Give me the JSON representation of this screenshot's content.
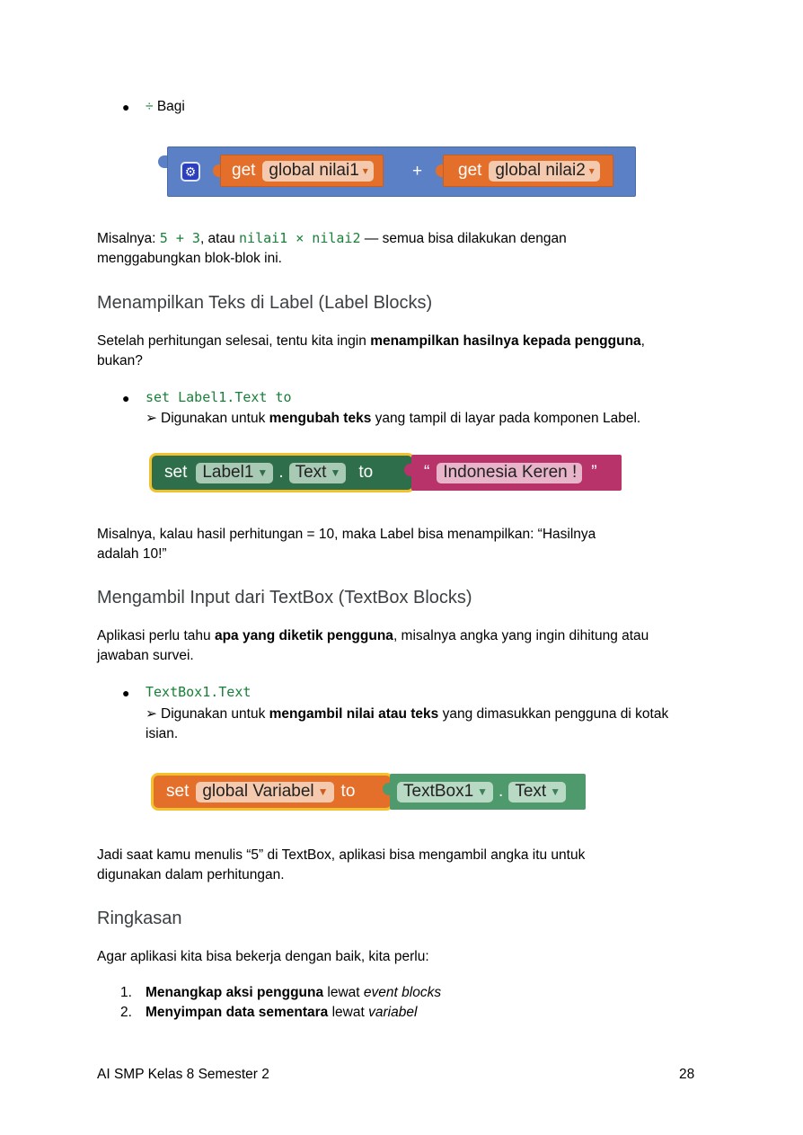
{
  "bullet_divide": {
    "symbol": "÷",
    "label": "Bagi"
  },
  "math_block": {
    "get_left": "get",
    "var_left": "global nilai1",
    "operator": "+",
    "get_right": "get",
    "var_right": "global nilai2",
    "dropdown": "▾"
  },
  "example1": {
    "prefix": "Misalnya: ",
    "code1": "5 + 3",
    "mid": ", atau ",
    "code2": "nilai1 × nilai2",
    "suffix": " — semua bisa dilakukan dengan",
    "line2": "menggabungkan blok-blok ini."
  },
  "section_label": {
    "heading": "Menampilkan Teks di Label (Label Blocks)",
    "intro_pre": "Setelah perhitungan selesai, tentu kita ingin ",
    "intro_bold": "menampilkan hasilnya kepada pengguna",
    "intro_post": ",",
    "intro_line2": "bukan?",
    "bullet_code": "set Label1.Text to",
    "desc_arrow": "➢",
    "desc_pre": "Digunakan untuk ",
    "desc_bold": "mengubah teks",
    "desc_post": " yang tampil di layar pada komponen Label.",
    "block": {
      "set": "set",
      "component": "Label1",
      "dot": ".",
      "property": "Text",
      "to": "to",
      "quote_open": "“",
      "text": "Indonesia Keren !",
      "quote_close": "”"
    },
    "example_line1": "Misalnya, kalau hasil perhitungan = 10, maka Label bisa menampilkan: “Hasilnya",
    "example_line2": "adalah 10!”"
  },
  "section_textbox": {
    "heading": "Mengambil Input dari TextBox (TextBox Blocks)",
    "intro_pre": "Aplikasi perlu tahu ",
    "intro_bold": "apa yang diketik pengguna",
    "intro_post": ", misalnya angka yang ingin dihitung atau",
    "intro_line2": "jawaban survei.",
    "bullet_code": "TextBox1.Text",
    "desc_arrow": "➢",
    "desc_pre": "Digunakan untuk ",
    "desc_bold": "mengambil nilai atau teks",
    "desc_post": " yang dimasukkan pengguna di kotak",
    "desc_line2": "isian.",
    "block": {
      "set": "set",
      "variable": "global Variabel",
      "to": "to",
      "component": "TextBox1",
      "dot": ".",
      "property": "Text"
    },
    "example_line1": "Jadi saat kamu menulis “5” di TextBox, aplikasi bisa mengambil angka itu untuk",
    "example_line2": "digunakan dalam perhitungan."
  },
  "section_summary": {
    "heading": "Ringkasan",
    "intro": "Agar aplikasi kita bisa bekerja dengan baik, kita perlu:",
    "items": [
      {
        "num": "1.",
        "bold": "Menangkap aksi pengguna",
        "mid": " lewat ",
        "italic": "event blocks"
      },
      {
        "num": "2.",
        "bold": "Menyimpan data sementara",
        "mid": " lewat ",
        "italic": "variabel"
      }
    ]
  },
  "footer": {
    "title": "AI SMP Kelas 8 Semester 2",
    "page": "28"
  },
  "colors": {
    "math_blue": "#5b80c5",
    "get_orange": "#e46f2a",
    "label_green": "#2f6e4b",
    "text_magenta": "#b8336a",
    "textbox_green": "#4e9a6c",
    "selected_yellow": "#f2c12e",
    "code_green": "#188038"
  }
}
